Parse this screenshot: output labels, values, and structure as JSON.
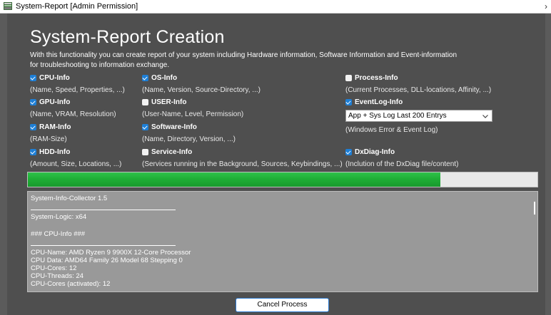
{
  "window": {
    "title": "System-Report [Admin Permission]",
    "close_glyph": "›"
  },
  "page": {
    "heading": "System-Report Creation",
    "description_line1": "With this functionality you can create report of your system including Hardware information, Software Information and Event-information",
    "description_line2": "for troubleshooting to information exchange."
  },
  "options": {
    "cpu": {
      "label": "CPU-Info",
      "desc": "(Name, Speed, Properties, ...)",
      "checked": true
    },
    "os": {
      "label": "OS-Info",
      "desc": "(Name, Version, Source-Directory, ...)",
      "checked": true
    },
    "process": {
      "label": "Process-Info",
      "desc": "(Current Processes, DLL-locations, Affinity, ...)",
      "checked": false
    },
    "gpu": {
      "label": "GPU-Info",
      "desc": "(Name, VRAM, Resolution)",
      "checked": true
    },
    "user": {
      "label": "USER-Info",
      "desc": "(User-Name, Level, Permission)",
      "checked": false
    },
    "eventlog": {
      "label": "EventLog-Info",
      "checked": true
    },
    "ram": {
      "label": "RAM-Info",
      "desc": "(RAM-Size)",
      "checked": true
    },
    "software": {
      "label": "Software-Info",
      "desc": "(Name, Directory, Version, ...)",
      "checked": true
    },
    "hdd": {
      "label": "HDD-Info",
      "desc": "(Amount, Size, Locations, ...)",
      "checked": true
    },
    "service": {
      "label": "Service-Info",
      "desc": "(Services running in the Background, Sources, Keybindings, ...)",
      "checked": false
    },
    "dxdiag": {
      "label": "DxDiag-Info",
      "desc": "(Inclution of the DxDiag file/content)",
      "checked": true
    }
  },
  "eventlog_select": {
    "value": "App + Sys Log Last 200 Entrys",
    "note": "(Windows Error & Event Log)"
  },
  "progress": {
    "fraction": 0.81
  },
  "log": {
    "lines": [
      "System-Info-Collector 1.5",
      "System-Logic: x64",
      "### CPU-Info ###",
      "CPU-Name: AMD Ryzen 9 9900X 12-Core Processor",
      "CPU Data: AMD64 Family 26 Model 68 Stepping 0",
      "CPU-Cores: 12",
      "CPU-Threads: 24",
      "CPU-Cores (activated): 12"
    ]
  },
  "actions": {
    "cancel_label": "Cancel Process"
  },
  "colors": {
    "accent": "#1e7fd6",
    "progress": "#1fae36",
    "background": "#4f4f4f"
  }
}
